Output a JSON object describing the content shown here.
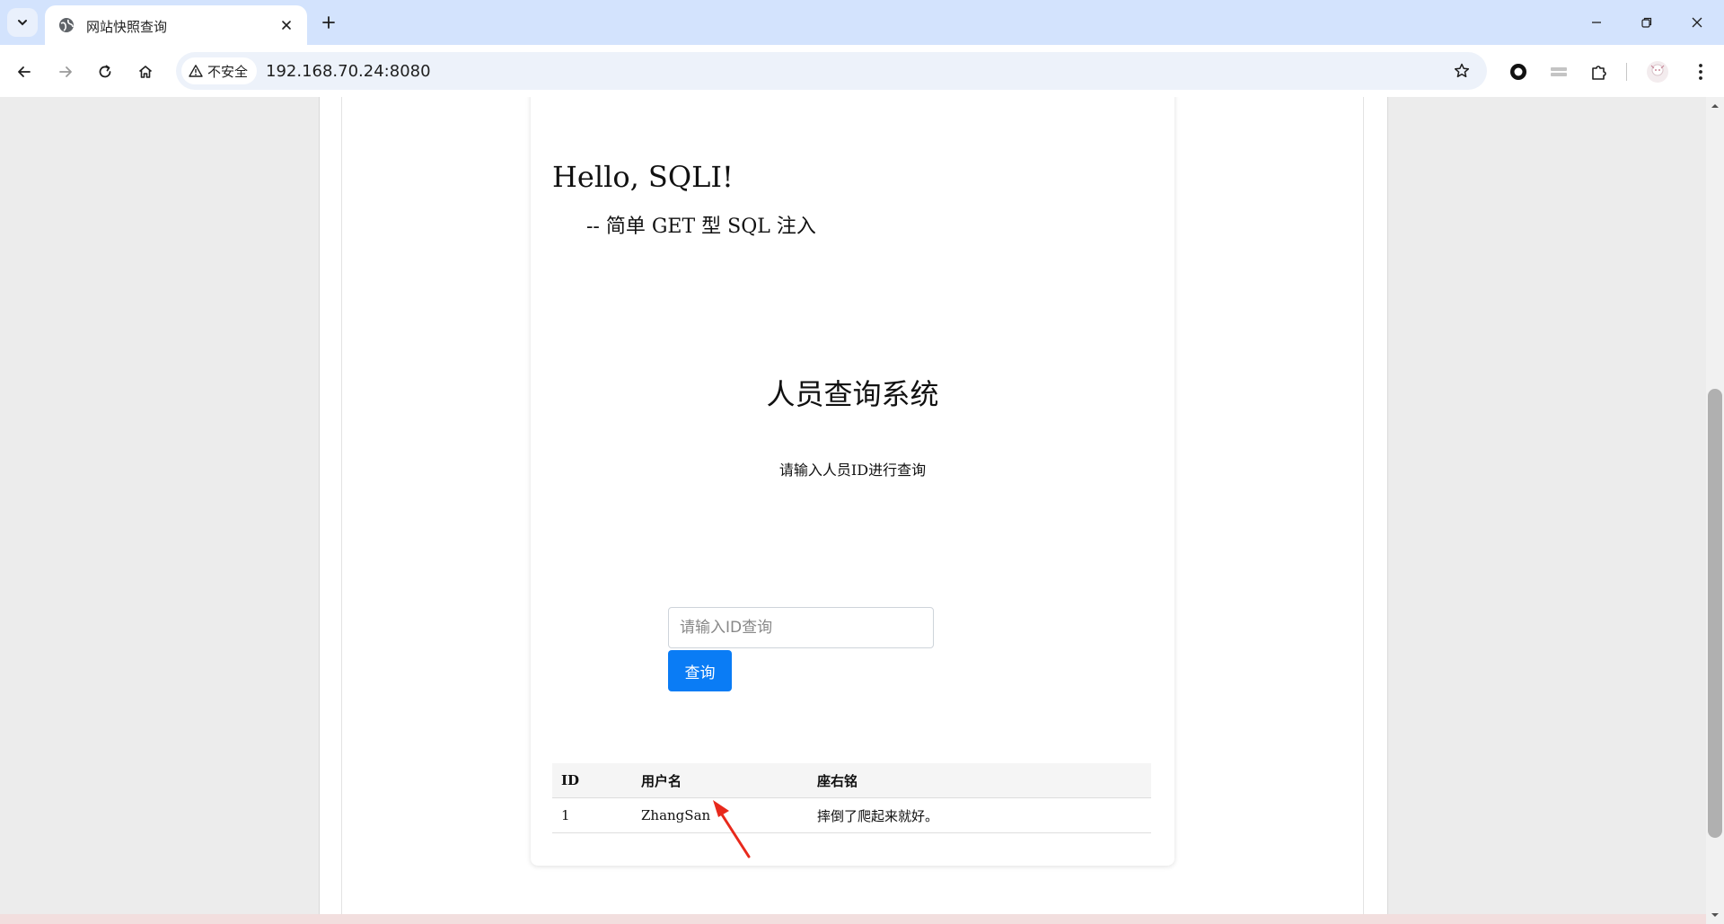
{
  "browser": {
    "tab_title": "网站快照查询",
    "security_label": "不安全",
    "url": "192.168.70.24:8080"
  },
  "page": {
    "hello": "Hello, SQLI!",
    "subtitle": "  -- 简单 GET 型 SQL 注入",
    "system_title": "人员查询系统",
    "instruction": "请输入人员ID进行查询",
    "search": {
      "placeholder": "请输入ID查询",
      "value": ""
    },
    "query_button": "查询",
    "table": {
      "headers": [
        "ID",
        "用户名",
        "座右铭"
      ],
      "rows": [
        [
          "1",
          "ZhangSan",
          "摔倒了爬起来就好。"
        ]
      ]
    }
  },
  "colors": {
    "accent": "#0a7cf5",
    "tabbar": "#d3e3fd",
    "annotation_arrow": "#e8291c"
  }
}
